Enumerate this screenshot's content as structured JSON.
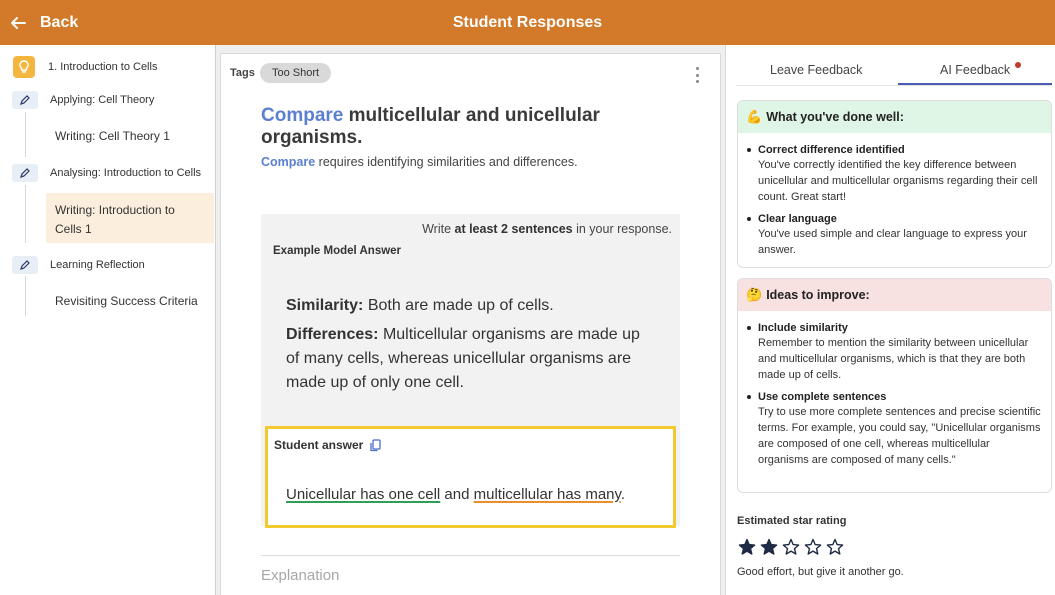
{
  "header": {
    "back_label": "Back",
    "title": "Student Responses",
    "bar_color": "#d27a29"
  },
  "sidebar": {
    "items": [
      {
        "label": "1. Introduction to Cells",
        "icon": "lightbulb-icon"
      },
      {
        "label": "Applying: Cell Theory",
        "icon": "pencil-icon"
      },
      {
        "label": "Writing: Cell Theory 1"
      },
      {
        "label": "Analysing: Introduction to Cells",
        "icon": "pencil-icon"
      },
      {
        "label_line1": "Writing: Introduction to",
        "label_line2": "Cells 1",
        "active": true
      },
      {
        "label": "Learning Reflection",
        "icon": "pencil-icon"
      },
      {
        "label": "Revisiting Success Criteria"
      }
    ]
  },
  "response": {
    "tags_label": "Tags",
    "tag": "Too Short",
    "question_keyword": "Compare",
    "question_rest": "multicellular and unicellular organisms.",
    "command_keyword": "Compare",
    "command_rest": "requires identifying similarities and differences.",
    "instruction_pre": "Write",
    "instruction_bold": "at least 2 sentences",
    "instruction_post": "in your response.",
    "example_label": "Example Model Answer",
    "similarity_label": "Similarity:",
    "similarity_text": "Both are made up of cells.",
    "differences_label": "Differences:",
    "differences_text": "Multicellular organisms are made up of many cells, whereas unicellular organisms are made up of only one cell.",
    "student_answer_label": "Student answer",
    "answer_part1": "Unicellular has one cell",
    "answer_join": "and",
    "answer_part2": "multicellular has many",
    "answer_end": ".",
    "explanation_label": "Explanation"
  },
  "feedback": {
    "tabs": [
      "Leave Feedback",
      "AI Feedback"
    ],
    "active_tab": "AI Feedback",
    "well": {
      "emoji": "💪",
      "heading": "What you've done well:",
      "items": [
        {
          "title": "Correct difference identified",
          "text": "You've correctly identified the key difference between unicellular and multicellular organisms regarding their cell count. Great start!"
        },
        {
          "title": "Clear language",
          "text": "You've used simple and clear language to express your answer."
        }
      ]
    },
    "improve": {
      "emoji": "🤔",
      "heading": "Ideas to improve:",
      "items": [
        {
          "title": "Include similarity",
          "text": "Remember to mention the similarity between unicellular and multicellular organisms, which is that they are both made up of cells."
        },
        {
          "title": "Use complete sentences",
          "text": "Try to use more complete sentences and precise scientific terms. For example, you could say, \"Unicellular organisms are composed of one cell, whereas multicellular organisms are composed of many cells.\""
        }
      ]
    },
    "rating_label": "Estimated star rating",
    "stars_filled": 2,
    "stars_total": 5,
    "rating_message": "Good effort, but give it another go."
  }
}
